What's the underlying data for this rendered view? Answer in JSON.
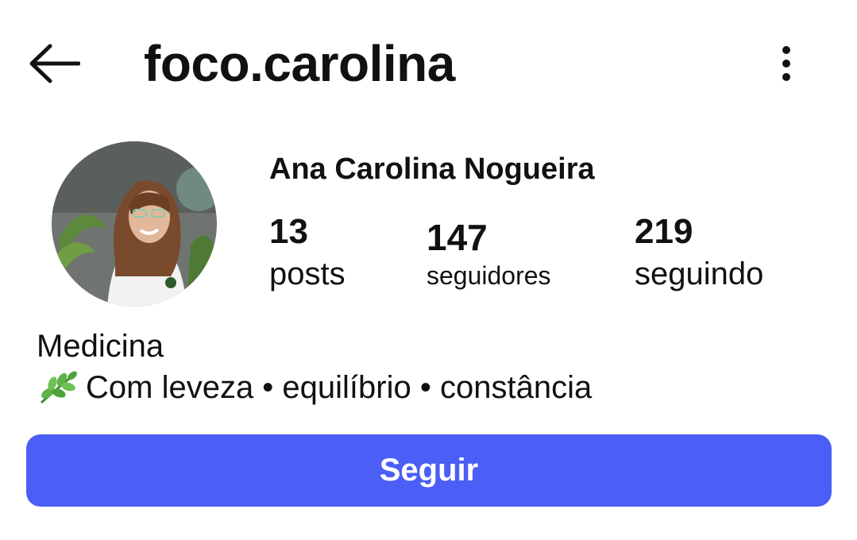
{
  "header": {
    "username": "foco.carolina",
    "back_icon": "arrow-left-icon",
    "more_icon": "more-vertical-icon"
  },
  "profile": {
    "full_name": "Ana Carolina Nogueira",
    "avatar_icon": "profile-photo",
    "stats": {
      "posts": {
        "value": "13",
        "label": "posts"
      },
      "followers": {
        "value": "147",
        "label": "seguidores"
      },
      "following": {
        "value": "219",
        "label": "seguindo"
      }
    },
    "bio": {
      "line1": "Medicina",
      "line2_icon": "herb-leaf-icon",
      "line2": "Com leveza • equilíbrio • constância"
    }
  },
  "actions": {
    "follow_label": "Seguir"
  },
  "colors": {
    "accent": "#4b5ef5",
    "text": "#111111",
    "background": "#ffffff"
  }
}
